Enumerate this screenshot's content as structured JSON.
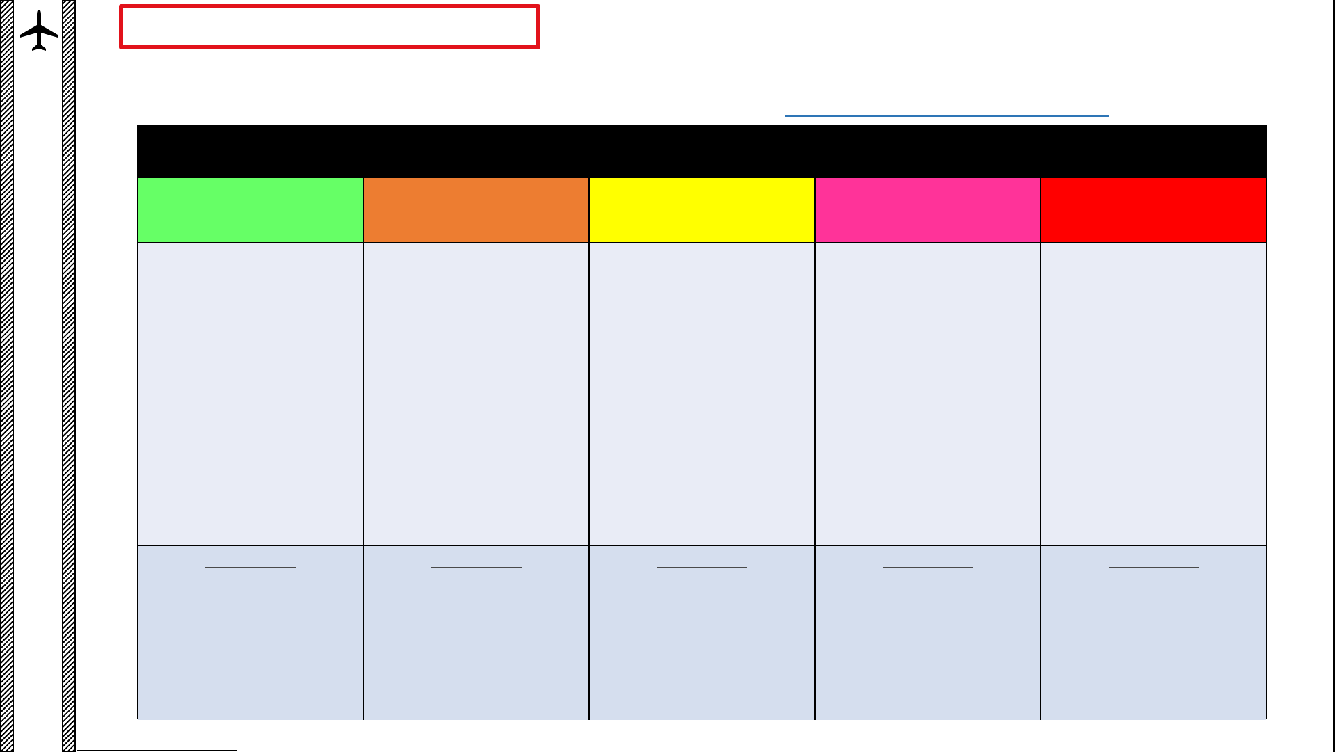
{
  "header": {
    "title_box_text": "",
    "link_text": ""
  },
  "grid": {
    "header_text": "",
    "columns": [
      {
        "label": "",
        "color": "#66ff66",
        "footer_label": ""
      },
      {
        "label": "",
        "color": "#ed7d31",
        "footer_label": ""
      },
      {
        "label": "",
        "color": "#ffff00",
        "footer_label": ""
      },
      {
        "label": "",
        "color": "#ff3399",
        "footer_label": ""
      },
      {
        "label": "",
        "color": "#ff0000",
        "footer_label": ""
      }
    ]
  },
  "colors": {
    "title_border": "#e2121b",
    "link": "#2e75b6",
    "body_fill": "#e9ecf6",
    "footer_fill": "#d5deee",
    "header_fill": "#000000"
  },
  "icons": [
    "airplane-icon"
  ]
}
